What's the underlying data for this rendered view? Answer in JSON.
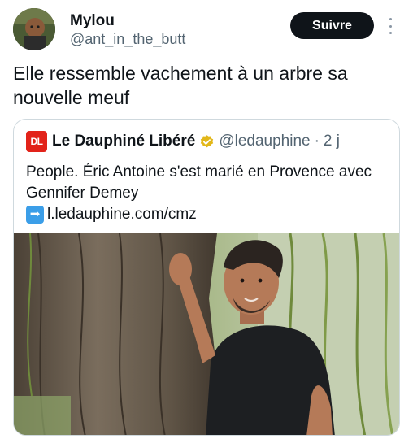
{
  "author": {
    "name": "Mylou",
    "handle": "@ant_in_the_butt"
  },
  "follow_label": "Suivre",
  "tweet_text": "Elle ressemble vachement à un arbre sa nouvelle meuf",
  "quote": {
    "logo_text": "DL",
    "name": "Le Dauphiné Libéré",
    "handle": "@ledauphine",
    "separator": "·",
    "time": "2 j",
    "text": "People. Éric Antoine s'est marié en Provence avec Gennifer Demey",
    "link_arrow": "➡",
    "link": "l.ledauphine.com/cmz"
  },
  "icons": {
    "more": "more-options-icon",
    "verified": "verified-badge-icon",
    "arrow": "right-arrow-icon"
  },
  "colors": {
    "follow_bg": "#0f1419",
    "handle": "#536471",
    "verified": "#e2b719",
    "logo": "#e2231a"
  }
}
